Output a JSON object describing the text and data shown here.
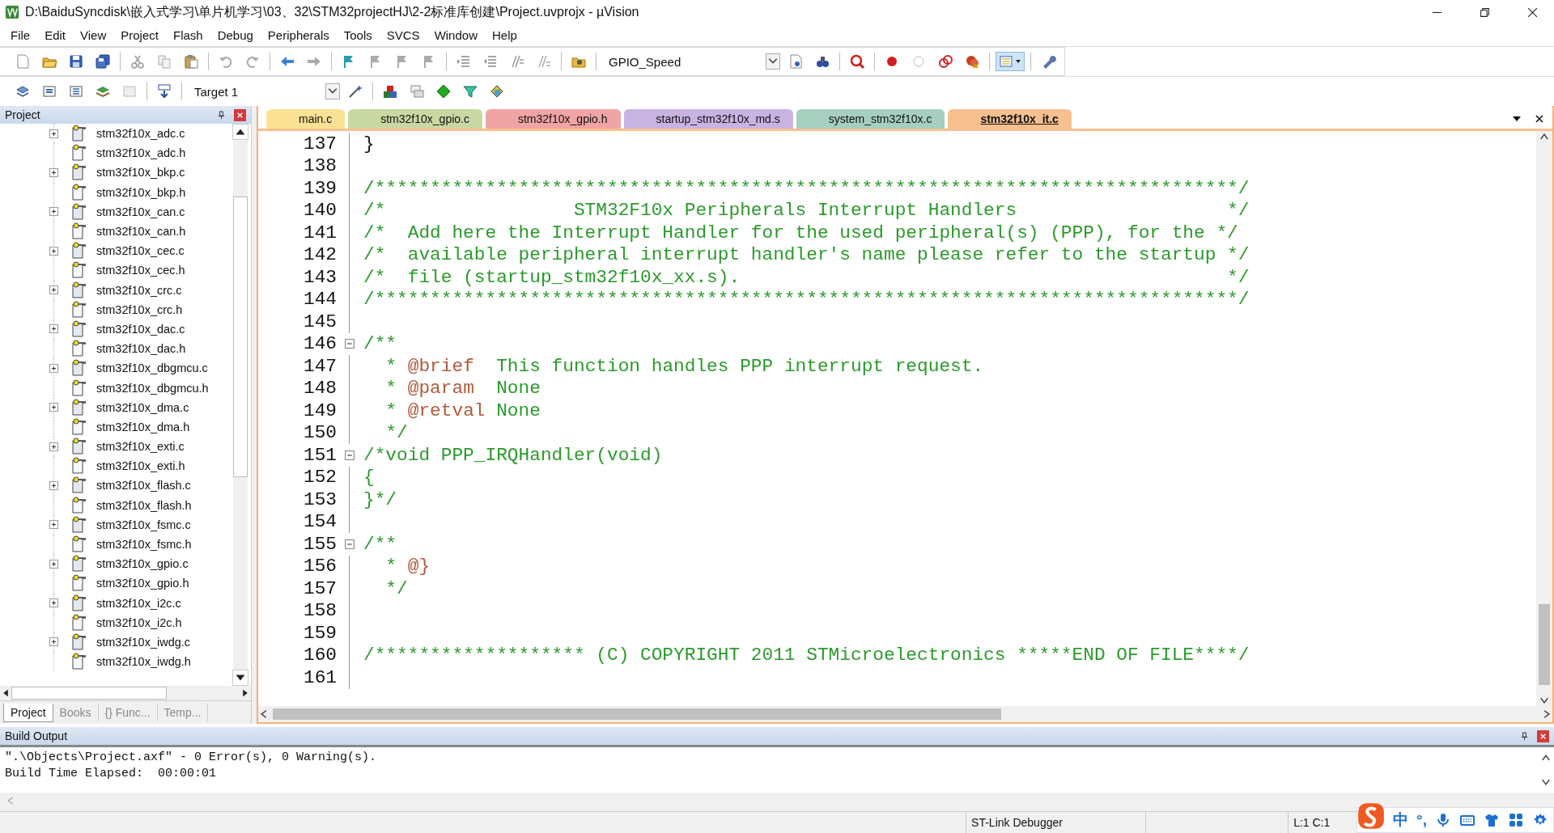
{
  "window": {
    "title": "D:\\BaiduSyncdisk\\嵌入式学习\\单片机学习\\03、32\\STM32projectHJ\\2-2标准库创建\\Project.uvprojx - µVision"
  },
  "menu": [
    "File",
    "Edit",
    "View",
    "Project",
    "Flash",
    "Debug",
    "Peripherals",
    "Tools",
    "SVCS",
    "Window",
    "Help"
  ],
  "toolbar": {
    "find_combo": "GPIO_Speed",
    "target_combo": "Target 1"
  },
  "project_panel": {
    "title": "Project",
    "items": [
      {
        "name": "stm32f10x_adc.c",
        "expandable": true
      },
      {
        "name": "stm32f10x_adc.h",
        "expandable": false
      },
      {
        "name": "stm32f10x_bkp.c",
        "expandable": true
      },
      {
        "name": "stm32f10x_bkp.h",
        "expandable": false
      },
      {
        "name": "stm32f10x_can.c",
        "expandable": true
      },
      {
        "name": "stm32f10x_can.h",
        "expandable": false
      },
      {
        "name": "stm32f10x_cec.c",
        "expandable": true
      },
      {
        "name": "stm32f10x_cec.h",
        "expandable": false
      },
      {
        "name": "stm32f10x_crc.c",
        "expandable": true
      },
      {
        "name": "stm32f10x_crc.h",
        "expandable": false
      },
      {
        "name": "stm32f10x_dac.c",
        "expandable": true
      },
      {
        "name": "stm32f10x_dac.h",
        "expandable": false
      },
      {
        "name": "stm32f10x_dbgmcu.c",
        "expandable": true
      },
      {
        "name": "stm32f10x_dbgmcu.h",
        "expandable": false
      },
      {
        "name": "stm32f10x_dma.c",
        "expandable": true
      },
      {
        "name": "stm32f10x_dma.h",
        "expandable": false
      },
      {
        "name": "stm32f10x_exti.c",
        "expandable": true
      },
      {
        "name": "stm32f10x_exti.h",
        "expandable": false
      },
      {
        "name": "stm32f10x_flash.c",
        "expandable": true
      },
      {
        "name": "stm32f10x_flash.h",
        "expandable": false
      },
      {
        "name": "stm32f10x_fsmc.c",
        "expandable": true
      },
      {
        "name": "stm32f10x_fsmc.h",
        "expandable": false
      },
      {
        "name": "stm32f10x_gpio.c",
        "expandable": true
      },
      {
        "name": "stm32f10x_gpio.h",
        "expandable": false
      },
      {
        "name": "stm32f10x_i2c.c",
        "expandable": true
      },
      {
        "name": "stm32f10x_i2c.h",
        "expandable": false
      },
      {
        "name": "stm32f10x_iwdg.c",
        "expandable": true
      },
      {
        "name": "stm32f10x_iwdg.h",
        "expandable": false
      }
    ],
    "tabs": [
      {
        "label": "Project",
        "selected": true
      },
      {
        "label": "Books",
        "selected": false
      },
      {
        "label": "{} Func...",
        "selected": false
      },
      {
        "label": "Temp...",
        "selected": false
      }
    ]
  },
  "editor": {
    "tabs": [
      {
        "label": "main.c",
        "color": "#fbe193",
        "selected": false
      },
      {
        "label": "stm32f10x_gpio.c",
        "color": "#c9d8a3",
        "selected": false
      },
      {
        "label": "stm32f10x_gpio.h",
        "color": "#f0a4a4",
        "selected": false
      },
      {
        "label": "startup_stm32f10x_md.s",
        "color": "#c9b3e3",
        "selected": false
      },
      {
        "label": "system_stm32f10x.c",
        "color": "#a6cfbf",
        "selected": false
      },
      {
        "label": "stm32f10x_it.c",
        "color": "#f8c08f",
        "selected": true
      }
    ],
    "lines": [
      {
        "number": "137",
        "fold_start": false,
        "segments": [
          {
            "text": "}",
            "kind": "plain"
          }
        ]
      },
      {
        "number": "138",
        "fold_start": false
      },
      {
        "number": "139",
        "fold_start": false,
        "segments": [
          {
            "text": "/******************************************************************************/",
            "kind": "comment"
          }
        ]
      },
      {
        "number": "140",
        "fold_start": false,
        "segments": [
          {
            "text": "/*                 STM32F10x Peripherals Interrupt Handlers                   */",
            "kind": "comment"
          }
        ]
      },
      {
        "number": "141",
        "fold_start": false,
        "segments": [
          {
            "text": "/*  Add here the Interrupt Handler for the used peripheral(s) (PPP), for the */",
            "kind": "comment"
          }
        ]
      },
      {
        "number": "142",
        "fold_start": false,
        "segments": [
          {
            "text": "/*  available peripheral interrupt handler's name please refer to the startup */",
            "kind": "comment"
          }
        ]
      },
      {
        "number": "143",
        "fold_start": false,
        "segments": [
          {
            "text": "/*  file (startup_stm32f10x_xx.s).                                            */",
            "kind": "comment"
          }
        ]
      },
      {
        "number": "144",
        "fold_start": false,
        "segments": [
          {
            "text": "/******************************************************************************/",
            "kind": "comment"
          }
        ]
      },
      {
        "number": "145",
        "fold_start": false
      },
      {
        "number": "146",
        "fold_start": true,
        "segments": [
          {
            "text": "/**",
            "kind": "comment"
          }
        ]
      },
      {
        "number": "147",
        "fold_start": false,
        "segments": [
          {
            "text": "  * ",
            "kind": "comment"
          },
          {
            "text": "@brief",
            "kind": "tag"
          },
          {
            "text": "  This function handles PPP interrupt request.",
            "kind": "comment"
          }
        ]
      },
      {
        "number": "148",
        "fold_start": false,
        "segments": [
          {
            "text": "  * ",
            "kind": "comment"
          },
          {
            "text": "@param",
            "kind": "tag"
          },
          {
            "text": "  None",
            "kind": "comment"
          }
        ]
      },
      {
        "number": "149",
        "fold_start": false,
        "segments": [
          {
            "text": "  * ",
            "kind": "comment"
          },
          {
            "text": "@retval",
            "kind": "tag"
          },
          {
            "text": " None",
            "kind": "comment"
          }
        ]
      },
      {
        "number": "150",
        "fold_start": false,
        "segments": [
          {
            "text": "  */",
            "kind": "comment"
          }
        ]
      },
      {
        "number": "151",
        "fold_start": true,
        "segments": [
          {
            "text": "/*void PPP_IRQHandler(void)",
            "kind": "comment"
          }
        ]
      },
      {
        "number": "152",
        "fold_start": false,
        "segments": [
          {
            "text": "{",
            "kind": "comment"
          }
        ]
      },
      {
        "number": "153",
        "fold_start": false,
        "segments": [
          {
            "text": "}*/",
            "kind": "comment"
          }
        ]
      },
      {
        "number": "154",
        "fold_start": false
      },
      {
        "number": "155",
        "fold_start": true,
        "segments": [
          {
            "text": "/**",
            "kind": "comment"
          }
        ]
      },
      {
        "number": "156",
        "fold_start": false,
        "segments": [
          {
            "text": "  * ",
            "kind": "comment"
          },
          {
            "text": "@}",
            "kind": "tag"
          }
        ]
      },
      {
        "number": "157",
        "fold_start": false,
        "segments": [
          {
            "text": "  */",
            "kind": "comment"
          }
        ]
      },
      {
        "number": "158",
        "fold_start": false
      },
      {
        "number": "159",
        "fold_start": false
      },
      {
        "number": "160",
        "fold_start": false,
        "segments": [
          {
            "text": "/******************* (C) COPYRIGHT 2011 STMicroelectronics *****END OF FILE****/",
            "kind": "comment"
          }
        ]
      },
      {
        "number": "161",
        "fold_start": false
      }
    ]
  },
  "build_output": {
    "title": "Build Output",
    "lines": [
      "\".\\Objects\\Project.axf\" - 0 Error(s), 0 Warning(s).",
      "Build Time Elapsed:  00:00:01"
    ]
  },
  "status_bar": {
    "debugger": "ST-Link Debugger",
    "position": "L:1 C:1",
    "ime": {
      "mode": "中",
      "punctuation": "°,"
    }
  }
}
